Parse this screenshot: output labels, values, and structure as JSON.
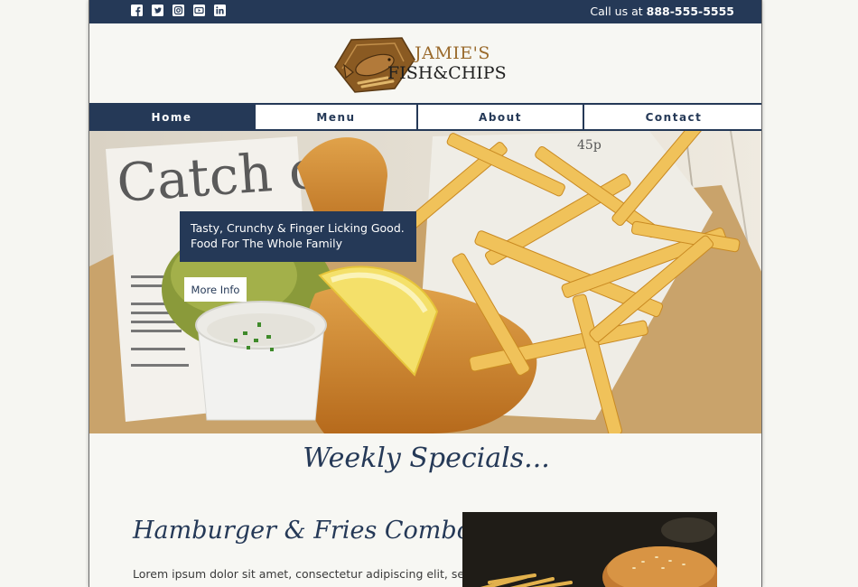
{
  "topbar": {
    "social_icons": [
      "facebook-icon",
      "twitter-icon",
      "instagram-icon",
      "youtube-icon",
      "linkedin-icon"
    ],
    "call_prefix": "Call us at",
    "phone": "888-555-5555"
  },
  "logo": {
    "line1": "JAMIE'S",
    "line2": "FISH&CHIPS"
  },
  "nav": {
    "items": [
      "Home",
      "Menu",
      "About",
      "Contact"
    ],
    "active": "Home"
  },
  "hero": {
    "headline": "Tasty, Crunchy & Finger Licking Good. Food For The Whole Family",
    "button_label": "More Info",
    "newspaper_text": "Catch o",
    "price_text": "45p"
  },
  "specials": {
    "title": "Weekly Specials...",
    "combo_title": "Hamburger & Fries Combo",
    "combo_text": "Lorem ipsum dolor sit amet, consectetur adipiscing elit, sed do"
  },
  "colors": {
    "navy": "#253957",
    "background": "#f7f7f3",
    "logo_gold": "#9a6a2c"
  }
}
